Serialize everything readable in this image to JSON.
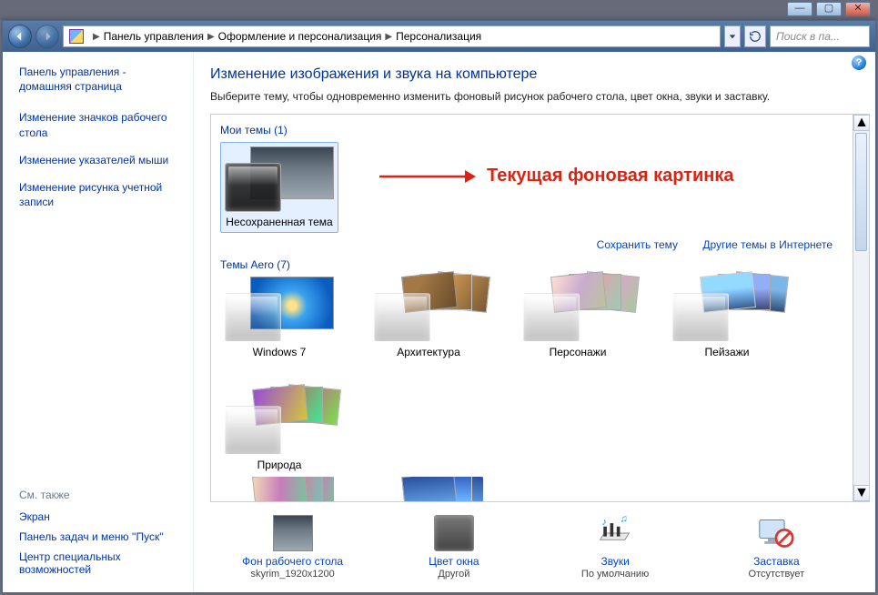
{
  "titlebar": {
    "min": "—",
    "max": "▢",
    "close": "✕"
  },
  "address": {
    "crumbs": [
      "Панель управления",
      "Оформление и персонализация",
      "Персонализация"
    ],
    "search_placeholder": "Поиск в па..."
  },
  "sidebar": {
    "home": "Панель управления - домашняя страница",
    "links": [
      "Изменение значков рабочего стола",
      "Изменение указателей мыши",
      "Изменение рисунка учетной записи"
    ],
    "see_also": "См. также",
    "links2": [
      "Экран",
      "Панель задач и меню ''Пуск''",
      "Центр специальных возможностей"
    ]
  },
  "content": {
    "heading": "Изменение изображения и звука на компьютере",
    "sub": "Выберите тему, чтобы одновременно изменить фоновый рисунок рабочего стола, цвет окна, звуки и заставку.",
    "my_themes_label": "Мои темы (1)",
    "my_theme_name": "Несохраненная тема",
    "save_theme": "Сохранить тему",
    "more_online": "Другие темы в Интернете",
    "aero_label": "Темы Aero (7)",
    "aero": [
      "Windows 7",
      "Архитектура",
      "Персонажи",
      "Пейзажи",
      "Природа"
    ]
  },
  "options": {
    "bg": {
      "title": "Фон рабочего стола",
      "value": "skyrim_1920x1200"
    },
    "color": {
      "title": "Цвет окна",
      "value": "Другой"
    },
    "sound": {
      "title": "Звуки",
      "value": "По умолчанию"
    },
    "saver": {
      "title": "Заставка",
      "value": "Отсутствует"
    }
  },
  "annotation": "Текущая фоновая картинка",
  "help": "?"
}
